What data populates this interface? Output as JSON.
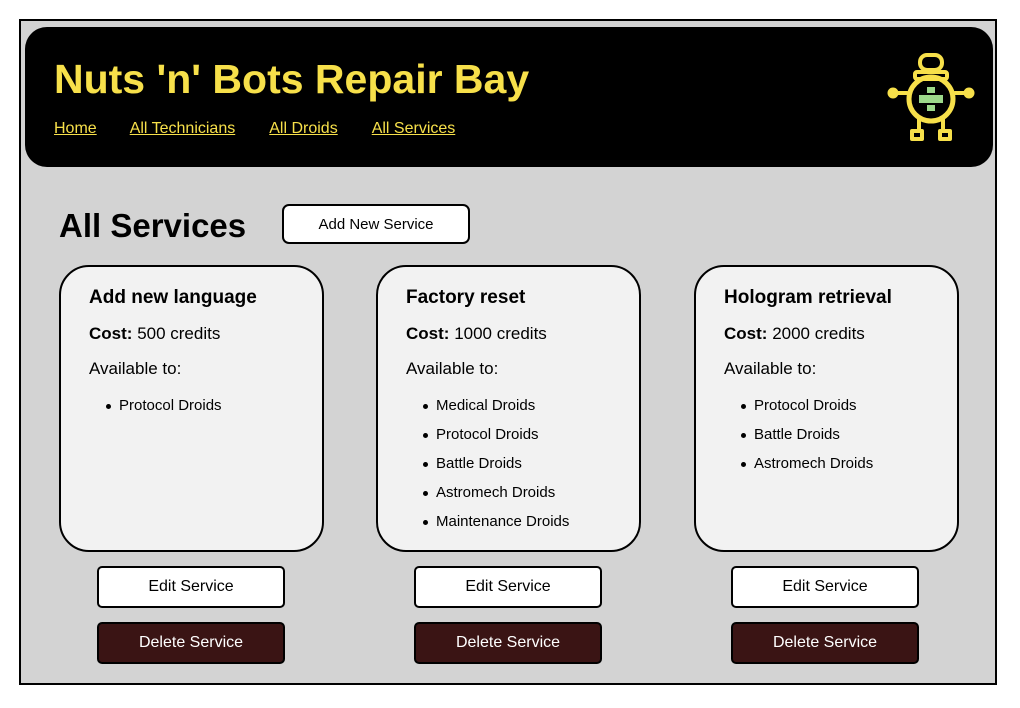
{
  "header": {
    "title": "Nuts 'n' Bots Repair Bay",
    "nav": [
      "Home",
      "All Technicians",
      "All Droids",
      "All Services"
    ],
    "logo_icon": "robot-medic-icon"
  },
  "main": {
    "heading": "All Services",
    "add_button": "Add New Service",
    "services": [
      {
        "name": "Add new language",
        "cost_label": "Cost:",
        "cost_value": "500 credits",
        "available_label": "Available to:",
        "droids": [
          "Protocol Droids"
        ],
        "edit_label": "Edit Service",
        "delete_label": "Delete Service"
      },
      {
        "name": "Factory reset",
        "cost_label": "Cost:",
        "cost_value": "1000 credits",
        "available_label": "Available to:",
        "droids": [
          "Medical Droids",
          "Protocol Droids",
          "Battle Droids",
          "Astromech Droids",
          "Maintenance Droids"
        ],
        "edit_label": "Edit Service",
        "delete_label": "Delete Service"
      },
      {
        "name": "Hologram retrieval",
        "cost_label": "Cost:",
        "cost_value": "2000 credits",
        "available_label": "Available to:",
        "droids": [
          "Protocol Droids",
          "Battle Droids",
          "Astromech Droids"
        ],
        "edit_label": "Edit Service",
        "delete_label": "Delete Service"
      }
    ]
  },
  "colors": {
    "brand_yellow": "#f7e04a",
    "header_bg": "#000000",
    "page_bg": "#d3d3d3",
    "card_bg": "#f2f2f2",
    "delete_bg": "#3a1414",
    "cross_green": "#9cd98a"
  }
}
